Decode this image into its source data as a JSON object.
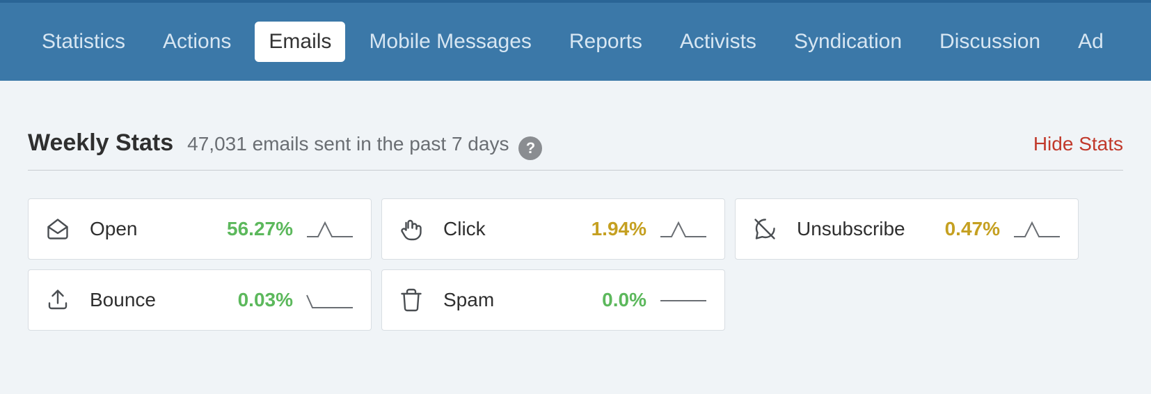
{
  "nav": {
    "tabs": [
      {
        "label": "Statistics",
        "active": false
      },
      {
        "label": "Actions",
        "active": false
      },
      {
        "label": "Emails",
        "active": true
      },
      {
        "label": "Mobile Messages",
        "active": false
      },
      {
        "label": "Reports",
        "active": false
      },
      {
        "label": "Activists",
        "active": false
      },
      {
        "label": "Syndication",
        "active": false
      },
      {
        "label": "Discussion",
        "active": false
      },
      {
        "label": "Ad",
        "active": false
      }
    ]
  },
  "header": {
    "title": "Weekly Stats",
    "subtitle": "47,031 emails sent in the past 7 days",
    "help": "?",
    "hide_label": "Hide Stats"
  },
  "stats": [
    {
      "icon": "envelope-open-icon",
      "label": "Open",
      "value": "56.27%",
      "value_class": "green",
      "spark": "peak"
    },
    {
      "icon": "hand-pointer-icon",
      "label": "Click",
      "value": "1.94%",
      "value_class": "olive",
      "spark": "peak"
    },
    {
      "icon": "comment-slash-icon",
      "label": "Unsubscribe",
      "value": "0.47%",
      "value_class": "olive",
      "spark": "peak"
    },
    {
      "icon": "arrow-up-tray-icon",
      "label": "Bounce",
      "value": "0.03%",
      "value_class": "green",
      "spark": "low"
    },
    {
      "icon": "trash-icon",
      "label": "Spam",
      "value": "0.0%",
      "value_class": "green",
      "spark": "flat"
    }
  ]
}
